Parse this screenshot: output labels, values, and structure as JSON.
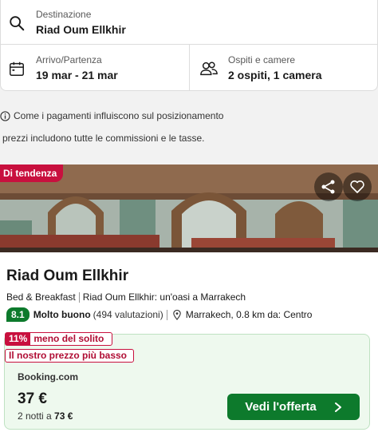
{
  "search": {
    "destination_label": "Destinazione",
    "destination_value": "Riad Oum Ellkhir",
    "dates_label": "Arrivo/Partenza",
    "dates_value": "19 mar - 21 mar",
    "guests_label": "Ospiti e camere",
    "guests_value": "2 ospiti, 1 camera"
  },
  "info": {
    "ranking_text": "Come i pagamenti influiscono sul posizionamento",
    "tax_text": "prezzi includono tutte le commissioni e le tasse."
  },
  "hotel": {
    "trend_badge": "Di tendenza",
    "name": "Riad Oum Ellkhir",
    "type": "Bed & Breakfast",
    "tagline": "Riad Oum Ellkhir: un'oasi a Marrakech",
    "score": "8.1",
    "score_word": "Molto buono",
    "reviews": "(494 valutazioni)",
    "location": "Marrakech, 0.8 km da: Centro"
  },
  "deal": {
    "discount_pct": "11%",
    "discount_text": "meno del solito",
    "lowest_price_text": "Il nostro prezzo più basso",
    "provider": "Booking.com",
    "price": "37 €",
    "nights_prefix": "2 notti a",
    "nights_total": "73 €",
    "cta_label": "Vedi l'offerta"
  },
  "colors": {
    "accent_green": "#0d7a2c",
    "badge_red": "#c8103e",
    "deal_bg": "#eef9ee"
  },
  "icons": [
    "search-icon",
    "calendar-icon",
    "guests-icon",
    "info-icon",
    "share-icon",
    "heart-icon",
    "location-pin-icon",
    "chevron-right-icon"
  ]
}
